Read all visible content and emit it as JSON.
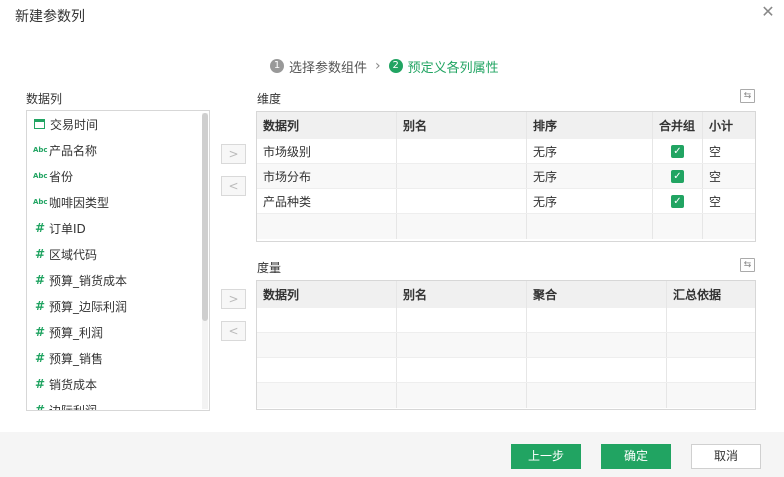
{
  "dialog": {
    "title": "新建参数列",
    "close": "✕"
  },
  "steps": [
    {
      "num": "1",
      "label": "选择参数组件"
    },
    {
      "num": "2",
      "label": "预定义各列属性"
    }
  ],
  "step_arrow": "›",
  "datacols": {
    "label": "数据列",
    "items": [
      {
        "icon": "calendar-icon",
        "label": "交易时间"
      },
      {
        "icon": "abc-icon",
        "label": "产品名称"
      },
      {
        "icon": "abc-icon",
        "label": "省份"
      },
      {
        "icon": "abc-icon",
        "label": "咖啡因类型"
      },
      {
        "icon": "hash-icon",
        "label": "订单ID"
      },
      {
        "icon": "hash-icon",
        "label": "区域代码"
      },
      {
        "icon": "hash-icon",
        "label": "预算_销货成本"
      },
      {
        "icon": "hash-icon",
        "label": "预算_边际利润"
      },
      {
        "icon": "hash-icon",
        "label": "预算_利润"
      },
      {
        "icon": "hash-icon",
        "label": "预算_销售"
      },
      {
        "icon": "hash-icon",
        "label": "销货成本"
      },
      {
        "icon": "hash-icon",
        "label": "边际利润"
      }
    ],
    "abc_glyph": "Abc",
    "hash_glyph": "#"
  },
  "arrows": {
    "right": ">",
    "left": "<"
  },
  "dimension": {
    "label": "维度",
    "headers": [
      "数据列",
      "别名",
      "排序",
      "合并组",
      "小计"
    ],
    "rows": [
      {
        "col": "市场级别",
        "alias": "",
        "sort": "无序",
        "merge": true,
        "subtotal": "空"
      },
      {
        "col": "市场分布",
        "alias": "",
        "sort": "无序",
        "merge": true,
        "subtotal": "空"
      },
      {
        "col": "产品种类",
        "alias": "",
        "sort": "无序",
        "merge": true,
        "subtotal": "空"
      }
    ]
  },
  "measure": {
    "label": "度量",
    "headers": [
      "数据列",
      "别名",
      "聚合",
      "汇总依据"
    ]
  },
  "swap_glyph": "⇆",
  "check_glyph": "✓",
  "buttons": {
    "prev": "上一步",
    "ok": "确定",
    "cancel": "取消"
  },
  "colors": {
    "accent": "#21a462"
  }
}
